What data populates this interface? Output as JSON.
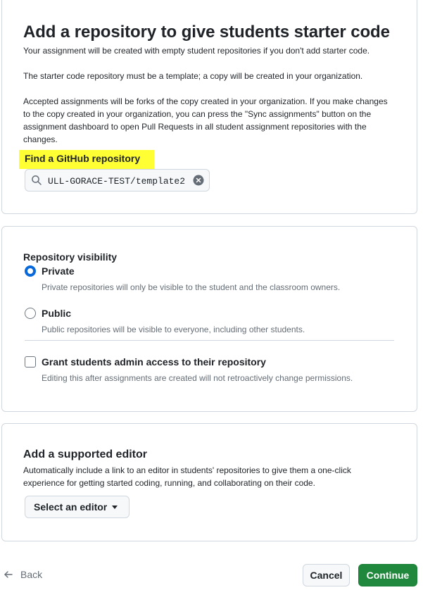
{
  "starter": {
    "title": "Add a repository to give students starter code",
    "paragraph1": "Your assignment will be created with empty student repositories if you don't add starter code.",
    "paragraph2": "The starter code repository must be a template; a copy will be created in your organization.",
    "paragraph3": "Accepted assignments will be forks of the copy created in your organization. If you make changes to the copy created in your organization, you can press the \"Sync assignments\" button on the assignment dashboard to open Pull Requests in all student assignment repositories with the changes.",
    "find_label": "Find a GitHub repository",
    "search_value": "ULL-GORACE-TEST/template2",
    "highlight_color": "#ffff33"
  },
  "visibility": {
    "label": "Repository visibility",
    "options": [
      {
        "label": "Private",
        "hint": "Private repositories will only be visible to the student and the classroom owners.",
        "selected": true
      },
      {
        "label": "Public",
        "hint": "Public repositories will be visible to everyone, including other students.",
        "selected": false
      }
    ],
    "admin": {
      "label": "Grant students admin access to their repository",
      "hint": "Editing this after assignments are created will not retroactively change permissions.",
      "checked": false
    }
  },
  "editor": {
    "label": "Add a supported editor",
    "description": "Automatically include a link to an editor in students' repositories to give them a one-click experience for getting started coding, running, and collaborating on their code.",
    "select_label": "Select an editor"
  },
  "footer": {
    "back_label": "Back",
    "cancel_label": "Cancel",
    "continue_label": "Continue"
  },
  "colors": {
    "accent": "#0969da",
    "primary_button": "#1f883d",
    "border": "#d0d7de"
  },
  "icons": {
    "search": "search-icon",
    "clear": "x-circle-fill-icon",
    "caret": "triangle-down-icon",
    "back": "arrow-left-icon"
  }
}
